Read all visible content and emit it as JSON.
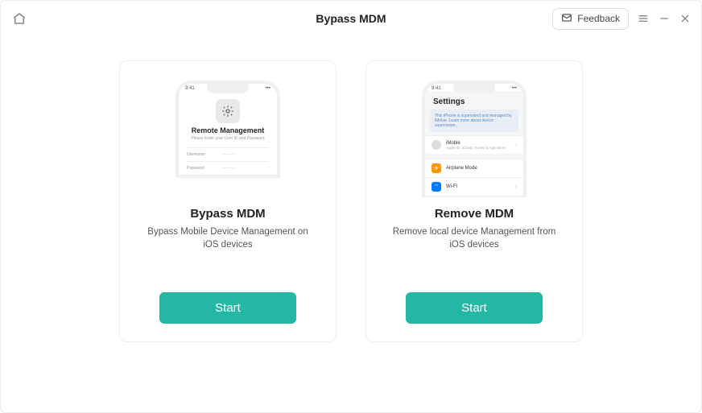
{
  "header": {
    "title": "Bypass MDM",
    "feedback_label": "Feedback"
  },
  "cards": [
    {
      "title": "Bypass MDM",
      "desc": "Bypass Mobile Device Management on iOS devices",
      "start_label": "Start",
      "phone": {
        "time": "9:41",
        "rm_title": "Remote Management",
        "rm_sub": "Please Enter your User ID and Password",
        "username_label": "Username",
        "password_label": "Password"
      }
    },
    {
      "title": "Remove MDM",
      "desc": "Remove local device Management from iOS devices",
      "start_label": "Start",
      "phone": {
        "time": "9:41",
        "settings_title": "Settings",
        "banner": "This iPhone is supervised and managed by iMobie. Learn more about device supervision...",
        "profile_name": "iMobie",
        "profile_sub": "Apple ID, iCloud, iTunes & App Store",
        "row_airplane": "Airplane Mode",
        "row_wifi": "Wi-Fi"
      }
    }
  ]
}
